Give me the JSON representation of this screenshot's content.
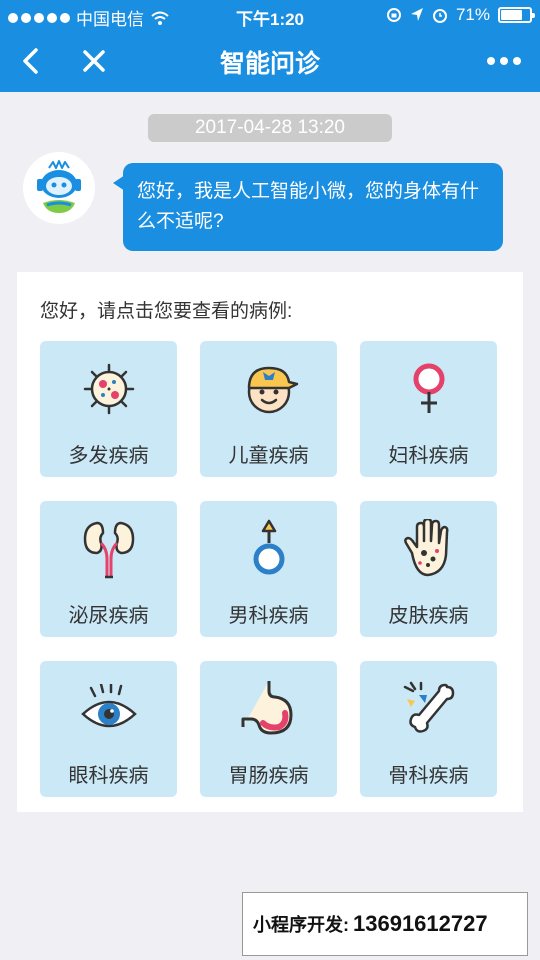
{
  "status_bar": {
    "carrier": "中国电信",
    "time": "下午1:20",
    "battery": "71%",
    "battery_level": 0.71
  },
  "nav": {
    "title": "智能问诊"
  },
  "chat": {
    "timestamp": "2017-04-28 13:20",
    "message": "您好，我是人工智能小微，您的身体有什么不适呢?"
  },
  "card": {
    "prompt": "您好，请点击您要查看的病例:",
    "items": [
      {
        "label": "多发疾病",
        "icon": "virus-icon"
      },
      {
        "label": "儿童疾病",
        "icon": "child-icon"
      },
      {
        "label": "妇科疾病",
        "icon": "female-symbol-icon"
      },
      {
        "label": "泌尿疾病",
        "icon": "kidney-icon"
      },
      {
        "label": "男科疾病",
        "icon": "male-symbol-icon"
      },
      {
        "label": "皮肤疾病",
        "icon": "skin-hand-icon"
      },
      {
        "label": "眼科疾病",
        "icon": "eye-icon"
      },
      {
        "label": "胃肠疾病",
        "icon": "stomach-icon"
      },
      {
        "label": "骨科疾病",
        "icon": "bone-icon"
      }
    ]
  },
  "footer": {
    "label": "小程序开发:",
    "phone": "13691612727"
  },
  "colors": {
    "primary": "#1a8ee1",
    "tile": "#cbe8f7",
    "background": "#efeff4"
  }
}
